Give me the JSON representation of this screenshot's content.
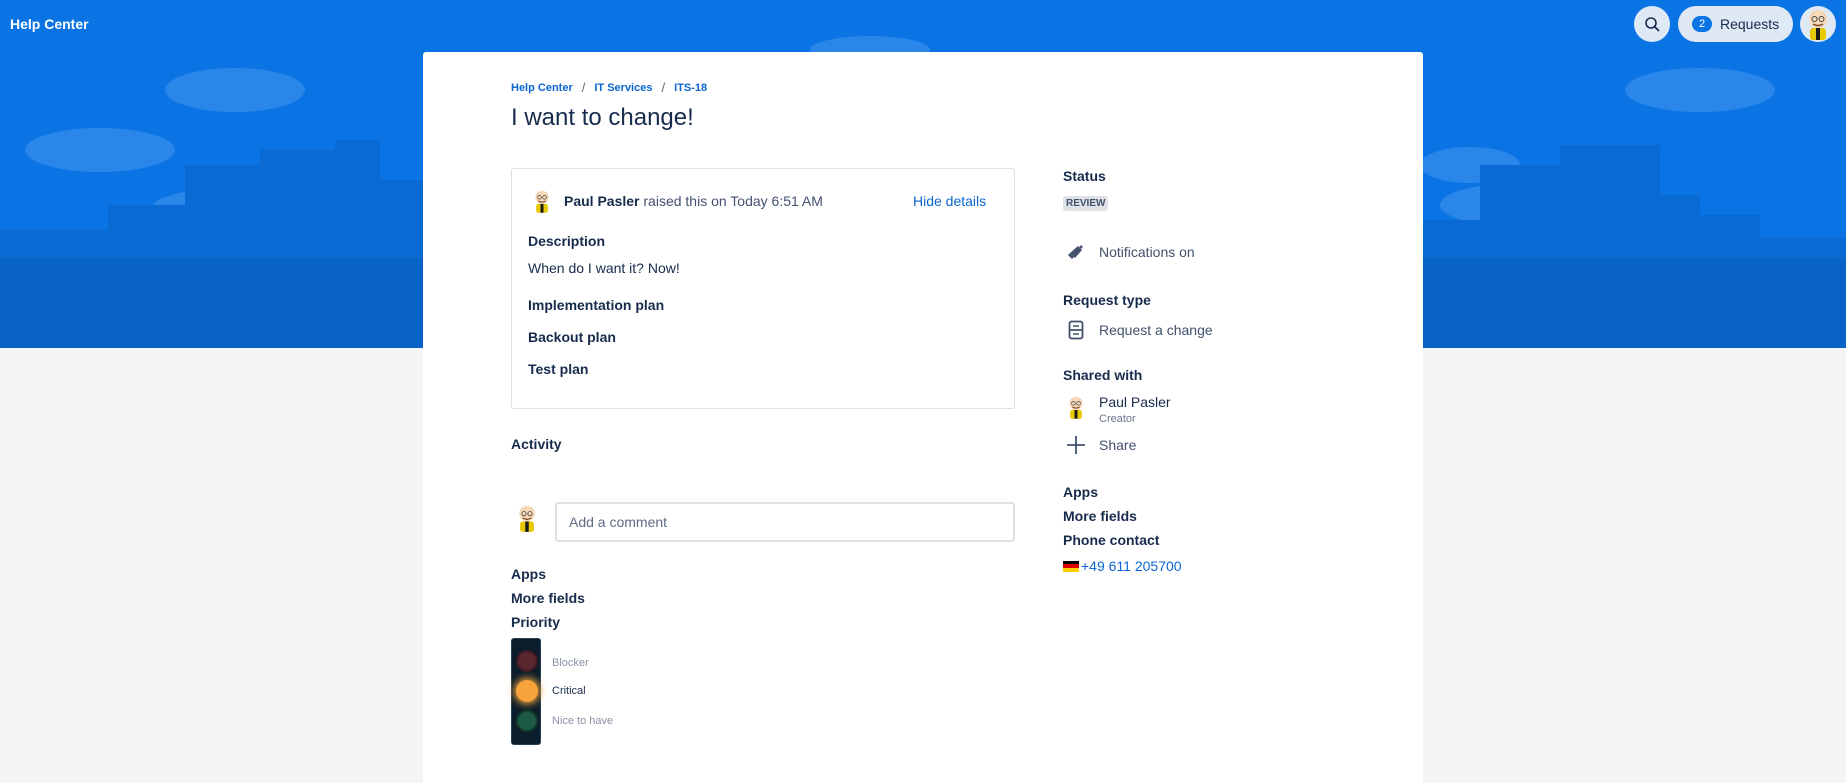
{
  "header": {
    "brand": "Help Center",
    "requests_label": "Requests",
    "requests_count": "2"
  },
  "breadcrumb": [
    "Help Center",
    "IT Services",
    "ITS-18"
  ],
  "page_title": "I want to change!",
  "request": {
    "reporter": "Paul Pasler",
    "raised_text": "raised this on Today 6:51 AM",
    "hide_details": "Hide details",
    "fields": [
      {
        "label": "Description",
        "value": "When do I want it? Now!"
      },
      {
        "label": "Implementation plan",
        "value": ""
      },
      {
        "label": "Backout plan",
        "value": ""
      },
      {
        "label": "Test plan",
        "value": ""
      }
    ]
  },
  "activity": {
    "title": "Activity",
    "comment_placeholder": "Add a comment"
  },
  "lower": {
    "apps": "Apps",
    "more_fields": "More fields",
    "priority_label": "Priority",
    "priority_levels": [
      "Blocker",
      "Critical",
      "Nice to have"
    ],
    "priority_selected": "Critical"
  },
  "sidebar": {
    "status_label": "Status",
    "status_value": "REVIEW",
    "notifications": "Notifications on",
    "request_type_label": "Request type",
    "request_type_value": "Request a change",
    "shared_with_label": "Shared with",
    "shared_user": "Paul Pasler",
    "shared_role": "Creator",
    "share": "Share",
    "apps": "Apps",
    "more_fields": "More fields",
    "phone_label": "Phone contact",
    "phone_value": "+49 611 205700"
  },
  "colors": {
    "brand_blue": "#0b74e5",
    "link_blue": "#0b66d0",
    "text_dark": "#172b4d"
  },
  "icons": [
    "search-icon",
    "user-avatar-icon",
    "megaphone-icon",
    "request-form-icon",
    "plus-icon",
    "germany-flag-icon",
    "traffic-light-icon"
  ]
}
